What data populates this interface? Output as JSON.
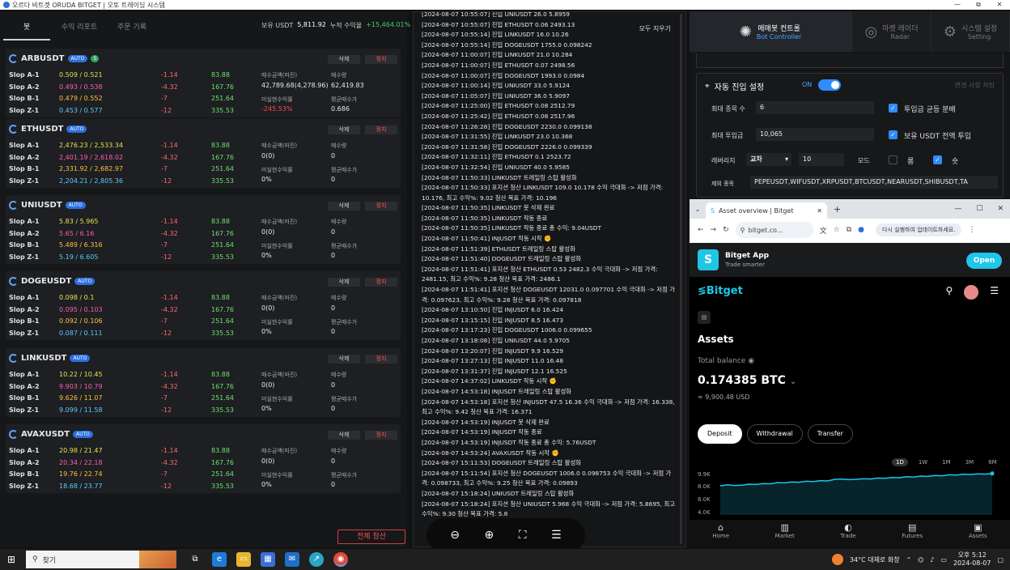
{
  "window": {
    "title": "오르다 비트겟 ORUDA BITGET | 오토 트레이딩 시스템",
    "controls": [
      "—",
      "⧉",
      "✕"
    ]
  },
  "tabs": [
    {
      "label": "봇",
      "active": true
    },
    {
      "label": "수익 리포트",
      "active": false
    },
    {
      "label": "주문 기록",
      "active": false
    }
  ],
  "totals": {
    "usdt_label": "보유 USDT",
    "usdt_value": "5,811.92",
    "profit_label": "누적 수익율",
    "profit_value": "+15,464.01%"
  },
  "cards": [
    {
      "symbol": "ARBUSDT",
      "badge": "AUTO",
      "extra_badge": "S",
      "delete": "삭제",
      "stop": "정지",
      "rows": [
        {
          "label": "Slop A-1",
          "price": "0.509 / 0.521",
          "neg": "-1.14",
          "pos": "83.88"
        },
        {
          "label": "Slop A-2",
          "price": "0.493 / 0.538",
          "neg": "-4.32",
          "pos": "167.76"
        },
        {
          "label": "Slop B-1",
          "price": "0.479 / 0.552",
          "neg": "-7",
          "pos": "251.64"
        },
        {
          "label": "Slop Z-1",
          "price": "0.453 / 0.577",
          "neg": "-12",
          "pos": "335.53"
        }
      ],
      "buy_amount_label": "매수금액(마진)",
      "buy_amount": "42,789.68(4,278.96)",
      "qty_label": "매수량",
      "qty": "62,419.83",
      "unrealized_label": "미실현수익률",
      "unrealized": "-245.53%",
      "avg_label": "평균매수가",
      "avg": "0.686"
    },
    {
      "symbol": "ETHUSDT",
      "badge": "AUTO",
      "extra_badge": "",
      "delete": "삭제",
      "stop": "정지",
      "rows": [
        {
          "label": "Slop A-1",
          "price": "2,476.23 / 2,533.34",
          "neg": "-1.14",
          "pos": "83.88"
        },
        {
          "label": "Slop A-2",
          "price": "2,401.19 / 2,618.02",
          "neg": "-4.32",
          "pos": "167.76"
        },
        {
          "label": "Slop B-1",
          "price": "2,331.92 / 2,682.97",
          "neg": "-7",
          "pos": "251.64"
        },
        {
          "label": "Slop Z-1",
          "price": "2,204.21 / 2,805.36",
          "neg": "-12",
          "pos": "335.53"
        }
      ],
      "buy_amount_label": "매수금액(마진)",
      "buy_amount": "0(0)",
      "qty_label": "매수량",
      "qty": "0",
      "unrealized_label": "미실현수익률",
      "unrealized": "0%",
      "avg_label": "평균매수가",
      "avg": "0"
    },
    {
      "symbol": "UNIUSDT",
      "badge": "AUTO",
      "extra_badge": "",
      "delete": "삭제",
      "stop": "정지",
      "rows": [
        {
          "label": "Slop A-1",
          "price": "5.83 / 5.965",
          "neg": "-1.14",
          "pos": "83.88"
        },
        {
          "label": "Slop A-2",
          "price": "5.65 / 6.16",
          "neg": "-4.32",
          "pos": "167.76"
        },
        {
          "label": "Slop B-1",
          "price": "5.489 / 6.316",
          "neg": "-7",
          "pos": "251.64"
        },
        {
          "label": "Slop Z-1",
          "price": "5.19 / 6.605",
          "neg": "-12",
          "pos": "335.53"
        }
      ],
      "buy_amount_label": "매수금액(마진)",
      "buy_amount": "0(0)",
      "qty_label": "매수량",
      "qty": "0",
      "unrealized_label": "미실현수익률",
      "unrealized": "0%",
      "avg_label": "평균매수가",
      "avg": "0"
    },
    {
      "symbol": "DOGEUSDT",
      "badge": "AUTO",
      "extra_badge": "",
      "delete": "삭제",
      "stop": "정지",
      "rows": [
        {
          "label": "Slop A-1",
          "price": "0.098 / 0.1",
          "neg": "-1.14",
          "pos": "83.88"
        },
        {
          "label": "Slop A-2",
          "price": "0.095 / 0.103",
          "neg": "-4.32",
          "pos": "167.76"
        },
        {
          "label": "Slop B-1",
          "price": "0.092 / 0.106",
          "neg": "-7",
          "pos": "251.64"
        },
        {
          "label": "Slop Z-1",
          "price": "0.087 / 0.111",
          "neg": "-12",
          "pos": "335.53"
        }
      ],
      "buy_amount_label": "매수금액(마진)",
      "buy_amount": "0(0)",
      "qty_label": "매수량",
      "qty": "0",
      "unrealized_label": "미실현수익률",
      "unrealized": "0%",
      "avg_label": "평균매수가",
      "avg": "0"
    },
    {
      "symbol": "LINKUSDT",
      "badge": "AUTO",
      "extra_badge": "",
      "delete": "삭제",
      "stop": "정지",
      "rows": [
        {
          "label": "Slop A-1",
          "price": "10.22 / 10.45",
          "neg": "-1.14",
          "pos": "83.88"
        },
        {
          "label": "Slop A-2",
          "price": "9.903 / 10.79",
          "neg": "-4.32",
          "pos": "167.76"
        },
        {
          "label": "Slop B-1",
          "price": "9.626 / 11.07",
          "neg": "-7",
          "pos": "251.64"
        },
        {
          "label": "Slop Z-1",
          "price": "9.099 / 11.58",
          "neg": "-12",
          "pos": "335.53"
        }
      ],
      "buy_amount_label": "매수금액(마진)",
      "buy_amount": "0(0)",
      "qty_label": "매수량",
      "qty": "0",
      "unrealized_label": "미실현수익률",
      "unrealized": "0%",
      "avg_label": "평균매수가",
      "avg": "0"
    },
    {
      "symbol": "AVAXUSDT",
      "badge": "AUTO",
      "extra_badge": "",
      "delete": "삭제",
      "stop": "정지",
      "rows": [
        {
          "label": "Slop A-1",
          "price": "20.98 / 21.47",
          "neg": "-1.14",
          "pos": "83.88"
        },
        {
          "label": "Slop A-2",
          "price": "20.34 / 22.18",
          "neg": "-4.32",
          "pos": "167.76"
        },
        {
          "label": "Slop B-1",
          "price": "19.76 / 22.74",
          "neg": "-7",
          "pos": "251.64"
        },
        {
          "label": "Slop Z-1",
          "price": "18.68 / 23.77",
          "neg": "-12",
          "pos": "335.53"
        }
      ],
      "buy_amount_label": "매수금액(마진)",
      "buy_amount": "0(0)",
      "qty_label": "매수량",
      "qty": "0",
      "unrealized_label": "미실현수익률",
      "unrealized": "0%",
      "avg_label": "평균매수가",
      "avg": "0"
    }
  ],
  "close_all": "전체 청산",
  "log": {
    "clear": "모두 지우기",
    "lines": [
      "[2024-08-07 10:55:07] 진입 UNIUSDT 26.0 5.8959",
      "[2024-08-07 10:55:07] 진입 ETHUSDT 0.06 2493.13",
      "[2024-08-07 10:55:14] 진입 LINKUSDT 16.0 10.26",
      "[2024-08-07 10:55:14] 진입 DOGEUSDT 1755.0 0.098242",
      "[2024-08-07 11:00:07] 진입 LINKUSDT 21.0 10.284",
      "[2024-08-07 11:00:07] 진입 ETHUSDT 0.07 2498.56",
      "[2024-08-07 11:00:07] 진입 DOGEUSDT 1993.0 0.0984",
      "[2024-08-07 11:00:14] 진입 UNIUSDT 33.0 5.9124",
      "[2024-08-07 11:05:07] 진입 UNIUSDT 36.0 5.9097",
      "[2024-08-07 11:25:00] 진입 ETHUSDT 0.08 2512.79",
      "[2024-08-07 11:25:42] 진입 ETHUSDT 0.08 2517.96",
      "[2024-08-07 11:26:28] 진입 DOGEUSDT 2230.0 0.099138",
      "[2024-08-07 11:31:55] 진입 LINKUSDT 23.0 10.368",
      "[2024-08-07 11:31:58] 진입 DOGEUSDT 2226.0 0.099339",
      "[2024-08-07 11:32:11] 진입 ETHUSDT 0.1 2523.72",
      "[2024-08-07 11:32:54] 진입 UNIUSDT 40.0 5.9585",
      "[2024-08-07 11:50:33] LINKUSDT 트레일링 스탑 활성화",
      "[2024-08-07 11:50:33] 포지션 청산 LINKUSDT 109.0 10.178 수익 극대화 -> 저점 가격: 10.176, 최고 수익%: 9.02 청산 목표 가격: 10.196",
      "[2024-08-07 11:50:35] LINKUSDT 봇 삭제 완료",
      "[2024-08-07 11:50:35] LINKUSDT 작동 종료",
      "[2024-08-07 11:50:35] LINKUSDT 작동 종료 총 수익: 9.04USDT",
      "[2024-08-07 11:50:41] INJUSDT 작동 시작 ✊",
      "[2024-08-07 11:51:39] ETHUSDT 트레일링 스탑 활성화",
      "[2024-08-07 11:51:40] DOGEUSDT 트레일링 스탑 활성화",
      "[2024-08-07 11:51:41] 포지션 청산 ETHUSDT 0.53 2482.3 수익 극대화 -> 저점 가격: 2481.15, 최고 수익%: 9.28 청산 목표 가격: 2486.1",
      "[2024-08-07 11:51:41] 포지션 청산 DOGEUSDT 12031.0 0.097701 수익 극대화 -> 저점 가격: 0.097623, 최고 수익%: 9.28 청산 목표 가격: 0.097818",
      "[2024-08-07 13:10:50] 진입 INJUSDT 6.0 16.424",
      "[2024-08-07 13:15:15] 진입 INJUSDT 8.5 16.473",
      "[2024-08-07 13:17:23] 진입 DOGEUSDT 1006.0 0.099655",
      "[2024-08-07 13:18:08] 진입 UNIUSDT 44.0 5.9705",
      "[2024-08-07 13:20:07] 진입 INJUSDT 9.9 16.529",
      "[2024-08-07 13:27:13] 진입 INJUSDT 11.0 16.48",
      "[2024-08-07 13:31:37] 진입 INJUSDT 12.1 16.525",
      "[2024-08-07 14:37:02] LINKUSDT 작동 시작 ✊",
      "[2024-08-07 14:53:18] INJUSDT 트레일링 스탑 활성화",
      "[2024-08-07 14:53:18] 포지션 청산 INJUSDT 47.5 16.36 수익 극대화 -> 저점 가격: 16.338, 최고 수익%: 9.42 청산 목표 가격: 16.371",
      "[2024-08-07 14:53:19] INJUSDT 봇 삭제 완료",
      "[2024-08-07 14:53:19] INJUSDT 작동 종료",
      "[2024-08-07 14:53:19] INJUSDT 작동 종료 총 수익: 5.76USDT",
      "[2024-08-07 14:53:24] AVAXUSDT 작동 시작 ✊",
      "[2024-08-07 15:11:53] DOGEUSDT 트레일링 스탑 활성화",
      "[2024-08-07 15:11:54] 포지션 청산 DOGEUSDT 1006.0 0.098753 수익 극대화 -> 저점 가격: 0.098733, 최고 수익%: 9.25 청산 목표 가격: 0.09893",
      "[2024-08-07 15:18:24] UNIUSDT 트레일링 스탑 활성화",
      "[2024-08-07 15:18:24] 포지션 청산 UNIUSDT 5.968 수익 극대화 -> 저점 가격: 5.8695, 최고 수익%: 9.30 청산 목표 가격: 5.8"
    ]
  },
  "controller": {
    "tabs": [
      {
        "k": "메매봇 컨트롤",
        "e": "Bot Controller",
        "icon": "openai-knot-icon",
        "active": true
      },
      {
        "k": "마켓 레이더",
        "e": "Radar",
        "icon": "radar-icon",
        "active": false
      },
      {
        "k": "시스템 설정",
        "e": "Setting",
        "icon": "gear-icon",
        "active": false
      }
    ],
    "section_title": "자동 진입 설정",
    "on_label": "ON",
    "toggle_on": true,
    "saved_label": "변경 사항 저장",
    "max_items_label": "최대 종목 수",
    "max_items": "6",
    "max_invest_label": "최대 투입금",
    "max_invest": "10,065",
    "leverage_label": "레버리지",
    "margin_mode": "교차",
    "leverage": "10",
    "mode_label": "모드",
    "long_label": "롱",
    "short_label": "숏",
    "long_checked": false,
    "short_checked": true,
    "even_split_label": "투입금 균등 분배",
    "even_split": true,
    "all_usdt_label": "보유 USDT 전액 투입",
    "all_usdt": true,
    "exclude_label": "제외 종목",
    "exclude": "PEPEUSDT,WIFUSDT,XRPUSDT,BTCUSDT,NEARUSDT,SHIBUSDT,TA"
  },
  "browser": {
    "tab_title": "Asset overview | Bitget",
    "url": "bitget.co...",
    "update_btn": "다시 실행하여 업데이트하세요.",
    "app_name": "Bitget App",
    "app_sub": "Trade smarter",
    "open_btn": "Open",
    "brand": "Bitget",
    "assets": "Assets",
    "total_balance": "Total balance",
    "btc": "0.174385 BTC",
    "usd": "≈ 9,900.48 USD",
    "actions": [
      "Deposit",
      "Withdrawal",
      "Transfer"
    ],
    "ranges": [
      "1D",
      "1W",
      "1M",
      "3M",
      "6M"
    ],
    "active_range": "1D",
    "nav": [
      "Home",
      "Market",
      "Trade",
      "Futures",
      "Assets"
    ]
  },
  "chart_data": {
    "type": "area",
    "yticks": [
      "9.9K",
      "8.0K",
      "6.0K",
      "4.0K"
    ],
    "ylim": [
      3500,
      10000
    ],
    "values": [
      8000,
      8150,
      8050,
      8100,
      8250,
      8200,
      8350,
      8300,
      8500,
      8450,
      8600,
      8550,
      8700,
      8650,
      8800,
      8750,
      9000,
      9050,
      8950,
      9000,
      9100,
      9050,
      9200,
      9150,
      9300,
      9250,
      9400,
      9350,
      9500,
      9450,
      9600,
      9550,
      9700,
      9650,
      9800,
      9750,
      9850,
      9800,
      9900
    ]
  },
  "taskbar": {
    "search": "찾기",
    "weather": "34°C 대체로 화창",
    "time": "오후 5:12",
    "date": "2024-08-07"
  }
}
